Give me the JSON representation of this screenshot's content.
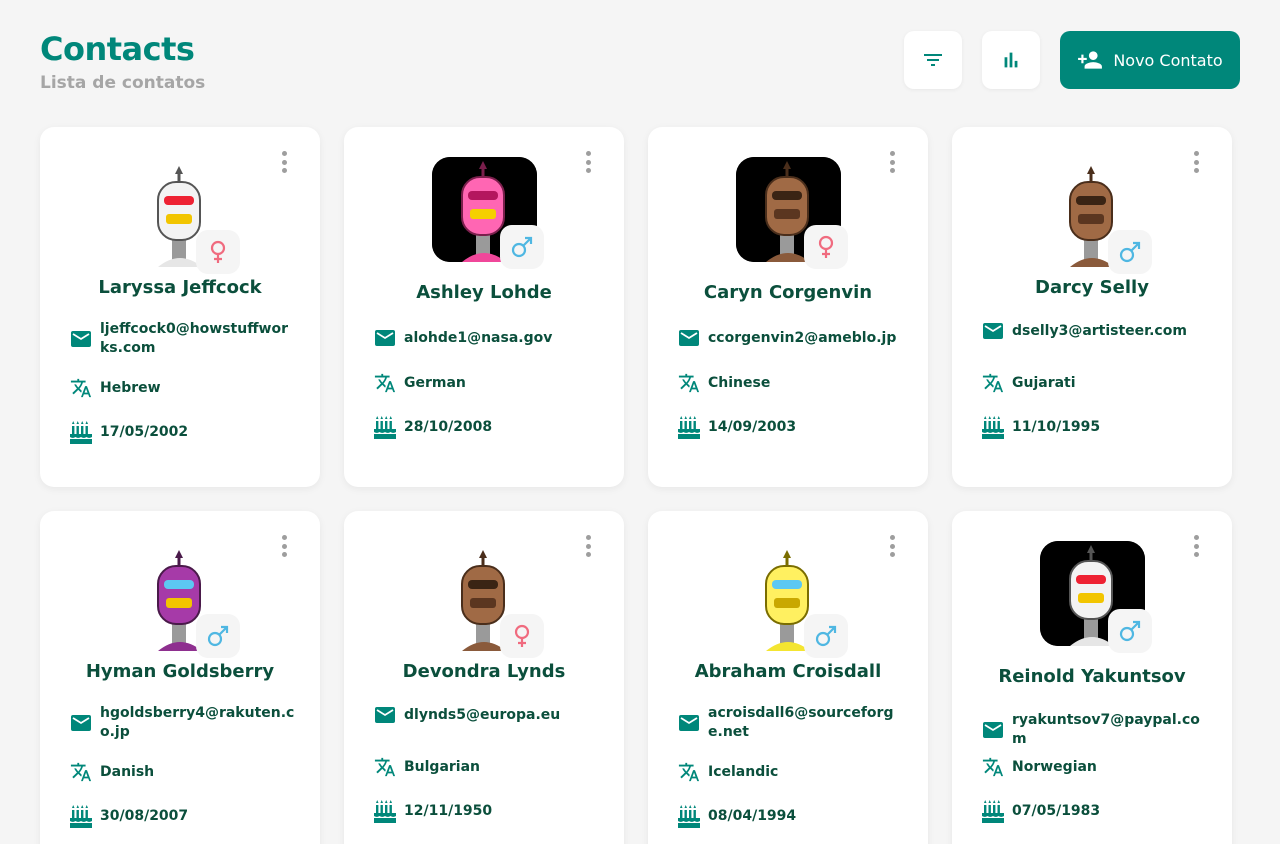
{
  "header": {
    "title": "Contacts",
    "subtitle": "Lista de contatos",
    "new_contact_label": "Novo Contato"
  },
  "colors": {
    "accent": "#00877a",
    "female": "#f06b7f",
    "male": "#4fb7e2",
    "text": "#0b4f3c"
  },
  "contacts": [
    {
      "name": "Laryssa Jeffcock",
      "email": "ljeffcock0@howstuffworks.com",
      "language": "Hebrew",
      "birthday": "17/05/2002",
      "gender": "female",
      "avatar": "white-robot"
    },
    {
      "name": "Ashley Lohde",
      "email": "alohde1@nasa.gov",
      "language": "German",
      "birthday": "28/10/2008",
      "gender": "male",
      "avatar": "pink-robot"
    },
    {
      "name": "Caryn Corgenvin",
      "email": "ccorgenvin2@ameblo.jp",
      "language": "Chinese",
      "birthday": "14/09/2003",
      "gender": "female",
      "avatar": "brown-robot"
    },
    {
      "name": "Darcy Selly",
      "email": "dselly3@artisteer.com",
      "language": "Gujarati",
      "birthday": "11/10/1995",
      "gender": "male",
      "avatar": "brown-robot"
    },
    {
      "name": "Hyman Goldsberry",
      "email": "hgoldsberry4@rakuten.co.jp",
      "language": "Danish",
      "birthday": "30/08/2007",
      "gender": "male",
      "avatar": "purple-robot"
    },
    {
      "name": "Devondra Lynds",
      "email": "dlynds5@europa.eu",
      "language": "Bulgarian",
      "birthday": "12/11/1950",
      "gender": "female",
      "avatar": "brown-robot"
    },
    {
      "name": "Abraham Croisdall",
      "email": "acroisdall6@sourceforge.net",
      "language": "Icelandic",
      "birthday": "08/04/1994",
      "gender": "male",
      "avatar": "yellow-robot"
    },
    {
      "name": "Reinold Yakuntsov",
      "email": "ryakuntsov7@paypal.com",
      "language": "Norwegian",
      "birthday": "07/05/1983",
      "gender": "male",
      "avatar": "white-robot"
    }
  ]
}
